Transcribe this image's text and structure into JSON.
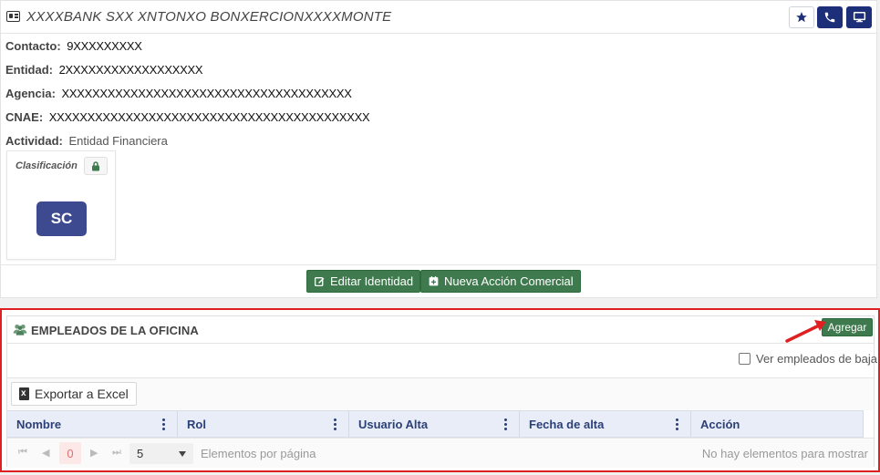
{
  "header": {
    "title": "XXXXBANK SXX XNTONXO BONXERCIONXXXXMONTE",
    "buttons": [
      {
        "icon": "star-icon"
      },
      {
        "icon": "phone-icon"
      },
      {
        "icon": "monitor-icon"
      }
    ]
  },
  "details": {
    "contacto": {
      "label": "Contacto:",
      "value": "9XXXXXXXXX"
    },
    "entidad": {
      "label": "Entidad:",
      "value": "2XXXXXXXXXXXXXXXXXX"
    },
    "agencia": {
      "label": "Agencia:",
      "value": "XXXXXXXXXXXXXXXXXXXXXXXXXXXXXXXXXXXXXX"
    },
    "cnae": {
      "label": "CNAE:",
      "value": "XXXXXXXXXXXXXXXXXXXXXXXXXXXXXXXXXXXXXXXXXX"
    },
    "actividad": {
      "label": "Actividad:",
      "value": "Entidad Financiera"
    }
  },
  "clasificacion": {
    "title": "Clasificación",
    "badge": "SC",
    "badge_color": "#3e4a8f"
  },
  "actions": {
    "editar": "Editar Identidad",
    "nueva": "Nueva Acción Comercial"
  },
  "empleados": {
    "title": "EMPLEADOS DE LA OFICINA",
    "add_label": "Agregar",
    "ver_baja_label": "Ver empleados de baja",
    "export_label": "Exportar a Excel",
    "columns": [
      "Nombre",
      "Rol",
      "Usuario Alta",
      "Fecha de alta",
      "Acción"
    ],
    "pager": {
      "current_page": "0",
      "page_size": "5",
      "page_size_label": "Elementos por página",
      "empty_message": "No hay elementos para mostrar"
    }
  },
  "colors": {
    "accent_green": "#3f7a4e",
    "header_blue": "#1e2f7a",
    "highlight_red": "#e02020"
  }
}
